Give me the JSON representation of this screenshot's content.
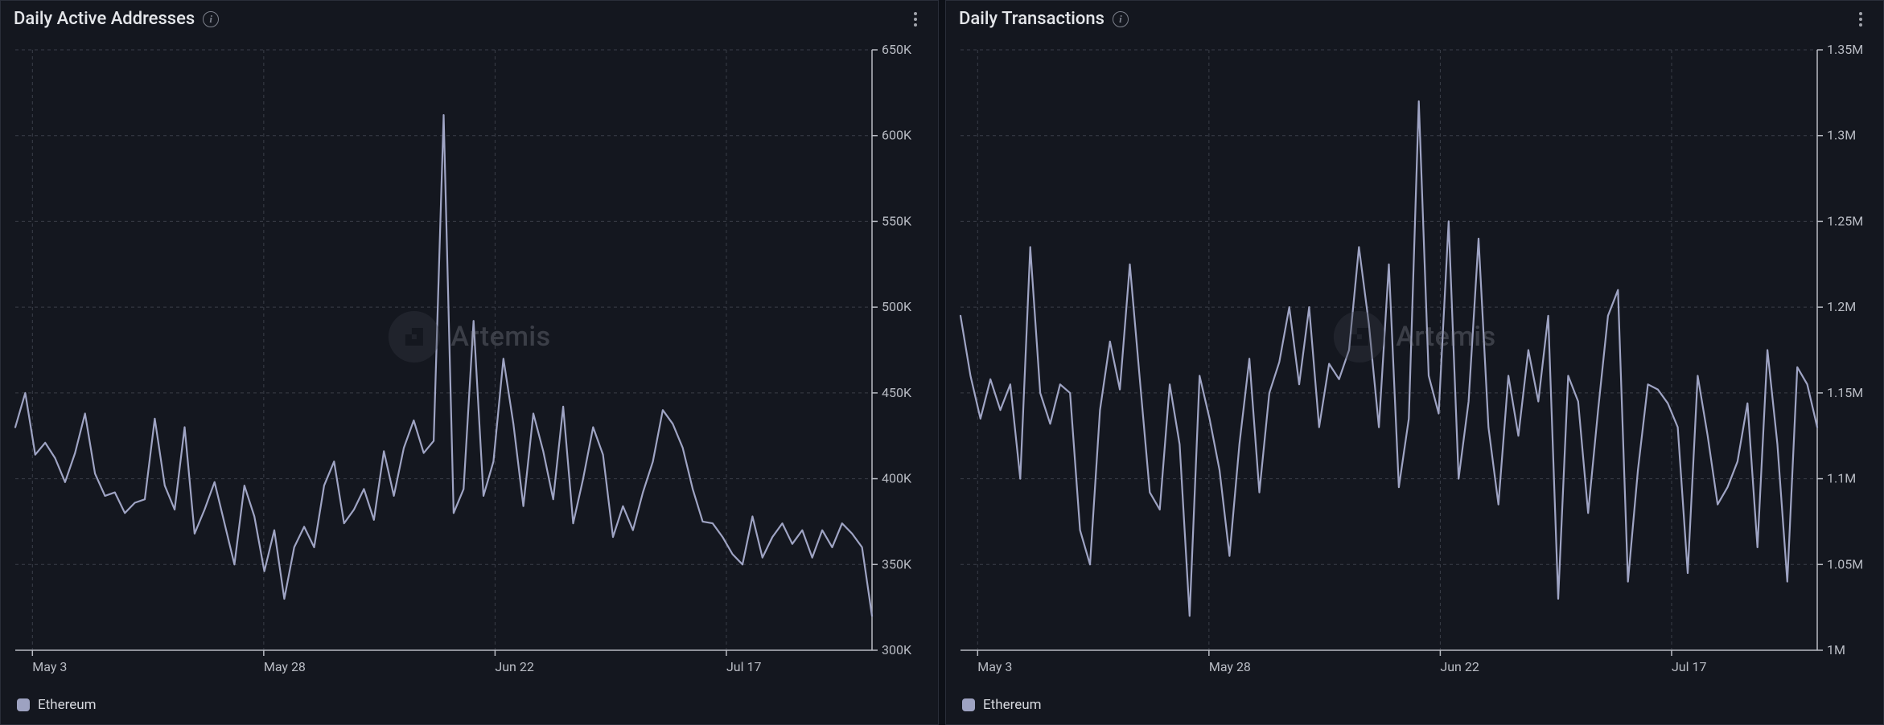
{
  "watermark": "Artemis",
  "panels": [
    {
      "title": "Daily Active Addresses",
      "legend": "Ethereum"
    },
    {
      "title": "Daily Transactions",
      "legend": "Ethereum"
    }
  ],
  "chart_data": [
    {
      "type": "line",
      "title": "Daily Active Addresses",
      "xlabel": "",
      "ylabel": "",
      "ylim": [
        300000,
        650000
      ],
      "x_ticks": [
        "May 3",
        "May 28",
        "Jun 22",
        "Jul 17"
      ],
      "y_ticks": [
        "300K",
        "350K",
        "400K",
        "450K",
        "500K",
        "550K",
        "600K",
        "650K"
      ],
      "series": [
        {
          "name": "Ethereum",
          "color": "#9fa4c4",
          "values": [
            430000,
            450000,
            414000,
            421000,
            412000,
            398000,
            415000,
            438000,
            403000,
            390000,
            392000,
            380000,
            386000,
            388000,
            435000,
            396000,
            382000,
            430000,
            368000,
            382000,
            398000,
            374000,
            350000,
            396000,
            378000,
            346000,
            370000,
            330000,
            360000,
            372000,
            360000,
            396000,
            410000,
            374000,
            382000,
            394000,
            376000,
            416000,
            390000,
            418000,
            434000,
            415000,
            422000,
            612000,
            380000,
            394000,
            492000,
            390000,
            410000,
            470000,
            432000,
            384000,
            438000,
            416000,
            388000,
            442000,
            374000,
            400000,
            430000,
            414000,
            366000,
            384000,
            370000,
            392000,
            410000,
            440000,
            432000,
            418000,
            394000,
            375000,
            374000,
            366000,
            356000,
            350000,
            378000,
            354000,
            366000,
            374000,
            362000,
            370000,
            354000,
            370000,
            360000,
            374000,
            368000,
            360000,
            320000
          ]
        }
      ]
    },
    {
      "type": "line",
      "title": "Daily Transactions",
      "xlabel": "",
      "ylabel": "",
      "ylim": [
        1000000,
        1350000
      ],
      "x_ticks": [
        "May 3",
        "May 28",
        "Jun 22",
        "Jul 17"
      ],
      "y_ticks": [
        "1M",
        "1.05M",
        "1.1M",
        "1.15M",
        "1.2M",
        "1.25M",
        "1.3M",
        "1.35M"
      ],
      "series": [
        {
          "name": "Ethereum",
          "color": "#9fa4c4",
          "values": [
            1195000,
            1160000,
            1135000,
            1158000,
            1140000,
            1155000,
            1100000,
            1235000,
            1150000,
            1132000,
            1155000,
            1150000,
            1070000,
            1050000,
            1140000,
            1180000,
            1152000,
            1225000,
            1158000,
            1092000,
            1082000,
            1155000,
            1120000,
            1020000,
            1160000,
            1135000,
            1105000,
            1055000,
            1120000,
            1170000,
            1092000,
            1150000,
            1168000,
            1200000,
            1155000,
            1200000,
            1130000,
            1167000,
            1158000,
            1175000,
            1235000,
            1190000,
            1130000,
            1225000,
            1095000,
            1135000,
            1320000,
            1160000,
            1138000,
            1250000,
            1100000,
            1145000,
            1240000,
            1130000,
            1085000,
            1160000,
            1125000,
            1175000,
            1145000,
            1195000,
            1030000,
            1160000,
            1145000,
            1080000,
            1140000,
            1195000,
            1210000,
            1040000,
            1105000,
            1155000,
            1152000,
            1144000,
            1130000,
            1045000,
            1160000,
            1125000,
            1085000,
            1095000,
            1110000,
            1144000,
            1060000,
            1175000,
            1120000,
            1040000,
            1165000,
            1155000,
            1130000
          ]
        }
      ]
    }
  ]
}
